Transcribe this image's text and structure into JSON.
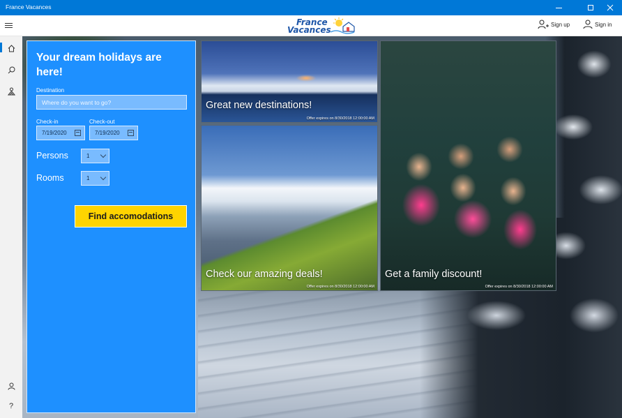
{
  "window": {
    "title": "France Vacances"
  },
  "header": {
    "logo": {
      "line1": "France",
      "line2": "Vacances"
    },
    "signup_label": "Sign up",
    "signin_label": "Sign in"
  },
  "nav": {
    "items": [
      {
        "icon": "home-icon"
      },
      {
        "icon": "search-icon"
      },
      {
        "icon": "trip-icon"
      },
      {
        "icon": "account-icon"
      },
      {
        "icon": "help-icon",
        "glyph": "?"
      }
    ]
  },
  "booking": {
    "heading": "Your dream holidays are here!",
    "destination_label": "Destination",
    "destination_placeholder": "Where do you want to go?",
    "destination_value": "",
    "checkin_label": "Check-in",
    "checkin_value": "7/19/2020",
    "checkout_label": "Check-out",
    "checkout_value": "7/19/2020",
    "persons_label": "Persons",
    "persons_value": "1",
    "rooms_label": "Rooms",
    "rooms_value": "1",
    "find_button": "Find accomodations",
    "accent_color": "#1e90ff",
    "button_color": "#ffd400"
  },
  "tiles": [
    {
      "caption": "Great new destinations!",
      "expiry": "Offer expires on   8/30/2018 12:00:00 AM"
    },
    {
      "caption": "Check our amazing deals!",
      "expiry": "Offer expires on   8/30/2018 12:00:00 AM"
    },
    {
      "caption": "Get a family discount!",
      "expiry": "Offer expires on   8/30/2018 12:00:00 AM"
    }
  ]
}
